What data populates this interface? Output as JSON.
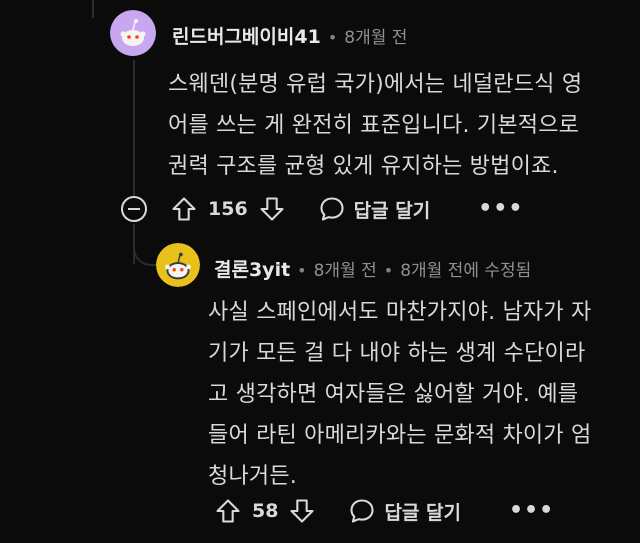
{
  "comment1": {
    "username": "린드버그베이비41",
    "time": "8개월 전",
    "body": "스웨덴(분명 유럽 국가)에서는 네덜란드식 영\n어를 쓰는 게 완전히 표준입니다. 기본적으로\n권력 구조를 균형 있게 유지하는 방법이죠.",
    "upvotes": "156",
    "reply_label": "답글 달기",
    "more_label": "•••",
    "avatar_color": "#c9a6f0"
  },
  "comment2": {
    "username": "결론3yit",
    "time": "8개월 전",
    "edited": "8개월 전에 수정됨",
    "body": "사실 스페인에서도 마찬가지야. 남자가 자\n기가 모든 걸 다 내야 하는 생계 수단이라\n고 생각하면 여자들은 싫어할 거야. 예를\n들어 라틴 아메리카와는 문화적 차이가 엄\n청나거든.",
    "upvotes": "58",
    "reply_label": "답글 달기",
    "more_label": "•••",
    "avatar_color": "#e8c21a"
  },
  "colors": {
    "background": "#0b0b0b",
    "text": "#d7dadc",
    "meta": "#8c9194"
  }
}
